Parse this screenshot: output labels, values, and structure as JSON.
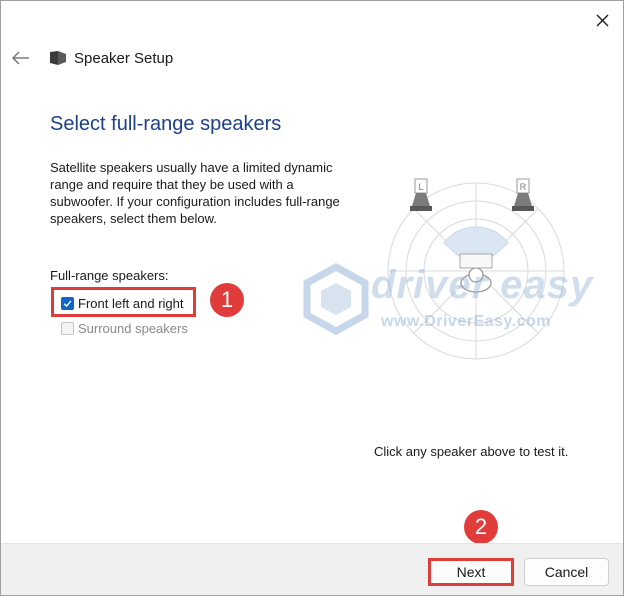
{
  "window": {
    "title": "Speaker Setup",
    "icons": {
      "close": "close-icon",
      "back": "back-arrow-icon",
      "app": "speaker-icon"
    }
  },
  "page": {
    "heading": "Select full-range speakers",
    "description": "Satellite speakers usually have a limited dynamic range and require that they be used with a subwoofer.  If your configuration includes full-range speakers, select them below.",
    "group_label": "Full-range speakers:",
    "options": [
      {
        "label": "Front left and right",
        "checked": true,
        "enabled": true
      },
      {
        "label": "Surround speakers",
        "checked": false,
        "enabled": false
      }
    ],
    "hint": "Click any speaker above to test it."
  },
  "diagram": {
    "left_label": "L",
    "right_label": "R"
  },
  "annotations": {
    "step1": "1",
    "step2": "2",
    "color": "#e13c3c"
  },
  "watermark": {
    "brand": "driver easy",
    "url": "www.DriverEasy.com"
  },
  "footer": {
    "next_label": "Next",
    "cancel_label": "Cancel"
  },
  "colors": {
    "heading": "#1e3f8a",
    "checkbox_accent": "#1464c8"
  }
}
